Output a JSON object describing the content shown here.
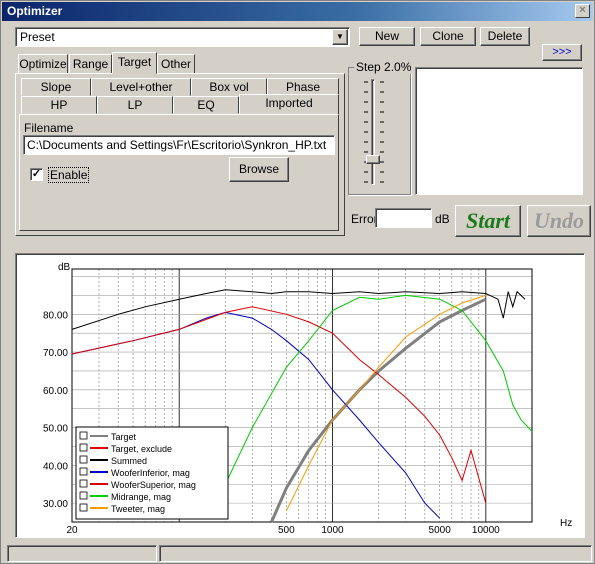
{
  "window": {
    "title": "Optimizer",
    "close": "×"
  },
  "preset": {
    "value": "Preset",
    "arrow": "▼"
  },
  "toolbar": {
    "new_label": "New",
    "clone_label": "Clone",
    "delete_label": "Delete",
    "more_label": ">>>"
  },
  "tabs": [
    "Optimize",
    "Range",
    "Target",
    "Other"
  ],
  "subtabs_row1": [
    "Slope",
    "Level+other",
    "Box vol",
    "Phase"
  ],
  "subtabs_row2": [
    "HP",
    "LP",
    "EQ",
    "Imported"
  ],
  "imported": {
    "filename_label": "Filename",
    "filename_value": "C:\\Documents and Settings\\Fr\\Escritorio\\Synkron_HP.txt",
    "enable_label": "Enable",
    "enable_checked": "✓",
    "browse_label": "Browse"
  },
  "step": {
    "label": "Step 2.0%"
  },
  "error": {
    "label": "Error",
    "unit": "dB",
    "value": ""
  },
  "actions": {
    "start_label": "Start",
    "undo_label": "Undo"
  },
  "colors": {
    "start": "#1a7a1a",
    "undo": "#9a9a9a"
  },
  "chart_data": {
    "type": "line",
    "ylabel": "dB",
    "xlabel": "Hz",
    "xscale": "log",
    "xlim": [
      20,
      20000
    ],
    "ylim": [
      25,
      92
    ],
    "yticks": [
      "30.00",
      "40.00",
      "50.00",
      "60.00",
      "70.00",
      "80.00"
    ],
    "ytick_values": [
      30,
      40,
      50,
      60,
      70,
      80
    ],
    "xticks": [
      "20",
      "500",
      "1000",
      "5000",
      "10000"
    ],
    "xtick_values": [
      20,
      500,
      1000,
      5000,
      10000
    ],
    "grid": true,
    "legend_position": "bottom-left",
    "series": [
      {
        "name": "Target",
        "color": "#808080",
        "x": [
          400,
          500,
          700,
          1000,
          1500,
          2000,
          3000,
          5000,
          7000,
          10000
        ],
        "y": [
          25,
          34,
          44,
          52,
          60,
          65,
          71,
          78,
          81,
          84
        ]
      },
      {
        "name": "Target, exclude",
        "color": "#e00000",
        "x": [],
        "y": []
      },
      {
        "name": "Summed",
        "color": "#000000",
        "x": [
          20,
          40,
          60,
          100,
          150,
          200,
          300,
          400,
          500,
          700,
          1000,
          1500,
          2000,
          3000,
          5000,
          7000,
          10000,
          12000,
          13000,
          14000,
          15000,
          16000,
          18000
        ],
        "y": [
          76,
          80,
          82,
          84,
          85.5,
          86.5,
          86,
          85.5,
          86,
          86,
          85.5,
          86,
          85.5,
          86,
          85.5,
          86,
          85.5,
          84,
          79,
          86,
          82,
          86,
          84
        ]
      },
      {
        "name": "WooferInferior, mag",
        "color": "#0000c8",
        "x": [
          20,
          50,
          100,
          150,
          200,
          300,
          400,
          500,
          700,
          1000,
          1500,
          2000,
          3000,
          4000,
          5000
        ],
        "y": [
          69.5,
          73,
          76,
          79,
          80.5,
          79,
          76,
          73,
          68,
          60,
          52,
          46,
          38,
          30,
          26
        ]
      },
      {
        "name": "WooferSuperior, mag",
        "color": "#dc0000",
        "x": [
          20,
          50,
          100,
          200,
          300,
          500,
          700,
          1000,
          1500,
          2000,
          3000,
          4000,
          5000,
          6000,
          7000,
          8000,
          10000
        ],
        "y": [
          69.5,
          73,
          76,
          80.5,
          82,
          80,
          78,
          75,
          68,
          64,
          58,
          53,
          48,
          42,
          36,
          44,
          30
        ]
      },
      {
        "name": "Midrange, mag",
        "color": "#00cc00",
        "x": [
          150,
          200,
          300,
          500,
          700,
          1000,
          1500,
          2000,
          3000,
          5000,
          7000,
          10000,
          13000,
          15000,
          17000,
          20000
        ],
        "y": [
          27,
          35,
          50,
          66,
          73,
          81,
          84.5,
          84,
          85,
          84,
          81,
          73,
          65,
          56,
          52,
          49
        ]
      },
      {
        "name": "Tweeter, mag",
        "color": "#ff9900",
        "x": [
          500,
          700,
          1000,
          1500,
          2000,
          3000,
          5000,
          7000,
          10000
        ],
        "y": [
          28,
          40,
          52,
          60,
          66,
          74,
          80,
          83,
          85
        ]
      }
    ]
  }
}
